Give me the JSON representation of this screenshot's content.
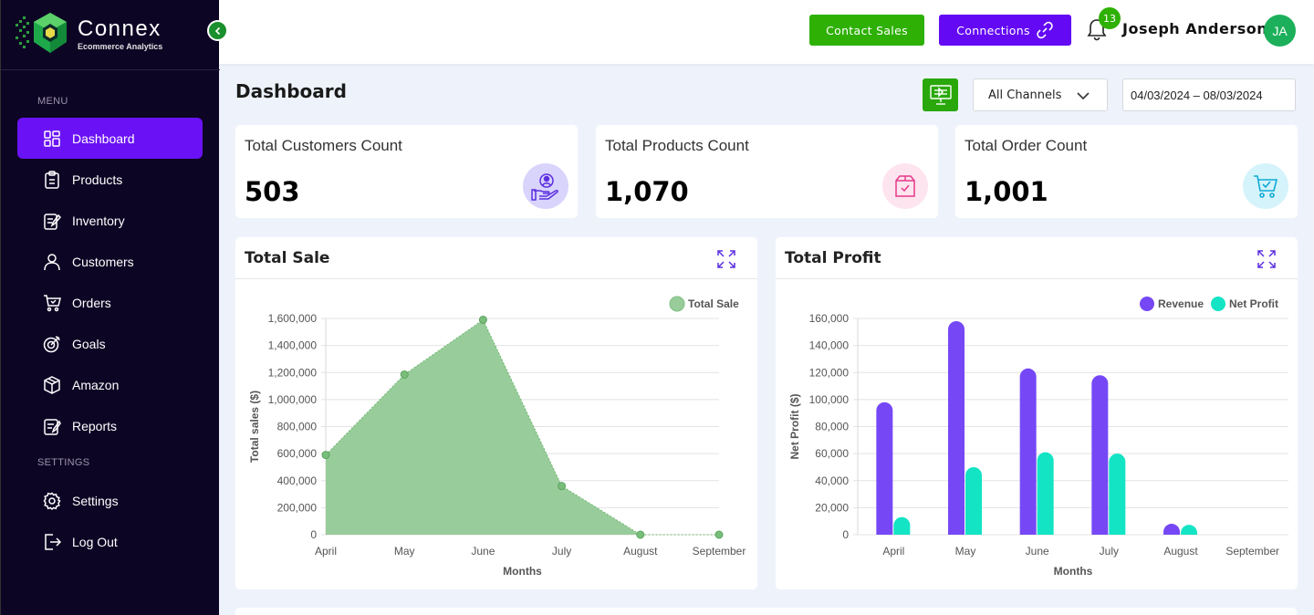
{
  "brand": {
    "name": "Connex",
    "tagline": "Ecommerce Analytics"
  },
  "sidebar": {
    "menu_label": "MENU",
    "settings_label": "SETTINGS",
    "items": [
      {
        "label": "Dashboard",
        "icon": "grid-icon"
      },
      {
        "label": "Products",
        "icon": "clipboard-icon"
      },
      {
        "label": "Inventory",
        "icon": "edit-list-icon"
      },
      {
        "label": "Customers",
        "icon": "user-icon"
      },
      {
        "label": "Orders",
        "icon": "cart-icon"
      },
      {
        "label": "Goals",
        "icon": "target-icon"
      },
      {
        "label": "Amazon",
        "icon": "box-icon"
      },
      {
        "label": "Reports",
        "icon": "report-icon"
      }
    ],
    "settings_items": [
      {
        "label": "Settings",
        "icon": "gear-icon"
      },
      {
        "label": "Log Out",
        "icon": "logout-icon"
      }
    ]
  },
  "header": {
    "contact_sales": "Contact Sales",
    "connections": "Connections",
    "notification_count": "13",
    "user_name": "Joseph Anderson",
    "user_initials": "JA"
  },
  "page": {
    "title": "Dashboard",
    "channel": "All Channels",
    "date_range": "04/03/2024 – 08/03/2024"
  },
  "stats": [
    {
      "label": "Total Customers Count",
      "value": "503"
    },
    {
      "label": "Total Products Count",
      "value": "1,070"
    },
    {
      "label": "Total Order Count",
      "value": "1,001"
    }
  ],
  "colors": {
    "accent": "#6a12f5",
    "green": "#2eb005",
    "sale_fill": "#98cc9a",
    "revenue": "#7648f5",
    "net_profit": "#12e4c4"
  },
  "chart_data": [
    {
      "type": "area",
      "title": "Total Sale",
      "categories": [
        "April",
        "May",
        "June",
        "July",
        "August",
        "September"
      ],
      "series": [
        {
          "name": "Total Sale",
          "values": [
            590000,
            1185000,
            1590000,
            360000,
            0,
            0
          ]
        }
      ],
      "xlabel": "Months",
      "ylabel": "Total sales ($)",
      "ylim": [
        0,
        1600000
      ],
      "yticks": [
        "1,600,000",
        "1,400,000",
        "1,200,000",
        "1,000,000",
        "800,000",
        "600,000",
        "400,000",
        "200,000",
        "0"
      ],
      "legend": "top-right",
      "grid": true
    },
    {
      "type": "bar",
      "title": "Total Profit",
      "categories": [
        "April",
        "May",
        "June",
        "July",
        "August",
        "September"
      ],
      "series": [
        {
          "name": "Revenue",
          "values": [
            98000,
            158000,
            123000,
            118000,
            4000,
            0
          ]
        },
        {
          "name": "Net Profit",
          "values": [
            13000,
            50000,
            61000,
            60000,
            2500,
            0
          ]
        }
      ],
      "xlabel": "Months",
      "ylabel": "Net Profit ($)",
      "ylim": [
        0,
        160000
      ],
      "yticks": [
        "160,000",
        "140,000",
        "120,000",
        "100,000",
        "80,000",
        "60,000",
        "40,000",
        "20,000",
        "0"
      ],
      "legend": "top-right",
      "grid": true
    }
  ]
}
